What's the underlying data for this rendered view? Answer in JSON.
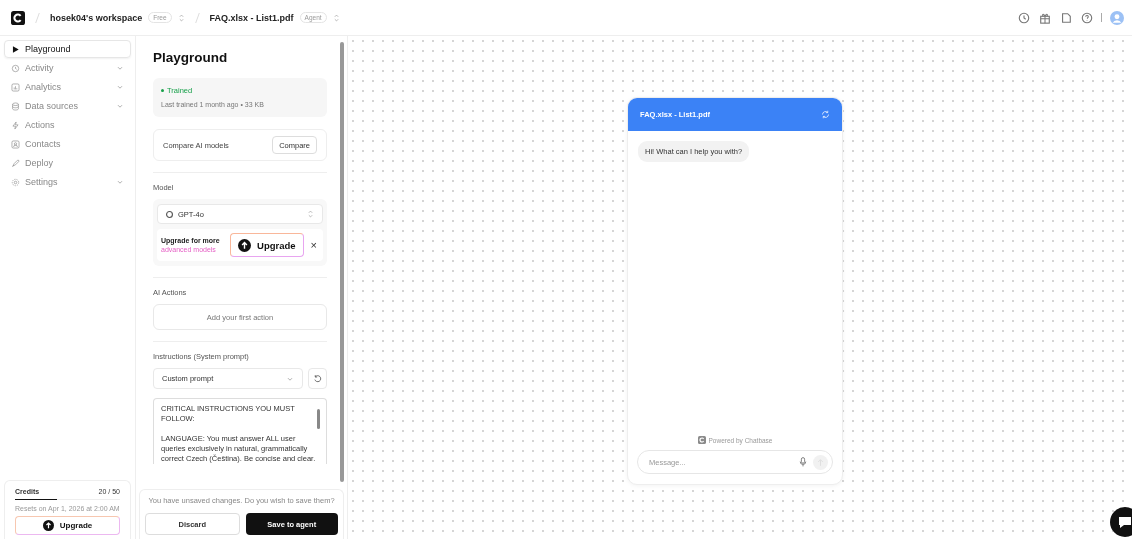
{
  "topbar": {
    "workspace": "hosek04's workspace",
    "plan_badge": "Free",
    "agent": "FAQ.xlsx - List1.pdf",
    "agent_badge": "Agent"
  },
  "sidebar": {
    "items": [
      {
        "label": "Playground",
        "selected": true,
        "expandable": false
      },
      {
        "label": "Activity",
        "selected": false,
        "expandable": true
      },
      {
        "label": "Analytics",
        "selected": false,
        "expandable": true
      },
      {
        "label": "Data sources",
        "selected": false,
        "expandable": true
      },
      {
        "label": "Actions",
        "selected": false,
        "expandable": false
      },
      {
        "label": "Contacts",
        "selected": false,
        "expandable": false
      },
      {
        "label": "Deploy",
        "selected": false,
        "expandable": false
      },
      {
        "label": "Settings",
        "selected": false,
        "expandable": true
      }
    ],
    "credits": {
      "label": "Credits",
      "count": "20 / 50",
      "level": 0.4,
      "reset": "Resets on Apr 1, 2026 at 2:00 AM",
      "button": "Upgrade"
    }
  },
  "panel": {
    "title": "Playground",
    "status": {
      "label": "Trained",
      "detail": "Last trained 1 month ago • 33 KB"
    },
    "compare": {
      "label": "Compare AI models",
      "button": "Compare"
    },
    "model": {
      "heading": "Model",
      "value": "GPT-4o",
      "upsell": "Upgrade for more",
      "upsell_link": "advanced models",
      "button": "Upgrade",
      "close": "×"
    },
    "actions": {
      "heading": "AI Actions",
      "button": "Add your first action"
    },
    "instructions": {
      "heading": "Instructions (System prompt)",
      "value": "Custom prompt",
      "prompt": "CRITICAL INSTRUCTIONS YOU MUST FOLLOW:\n\nLANGUAGE: You must answer ALL user queries exclusively in natural, grammatically correct Czech (Čeština). Be concise and clear."
    },
    "unsaved": {
      "message": "You have unsaved changes. Do you wish to save them?",
      "discard": "Discard",
      "save": "Save to agent"
    }
  },
  "chat": {
    "title": "FAQ.xlsx - List1.pdf",
    "messages": [
      "Hi! What can I help you with?"
    ],
    "powered": "Powered by Chatbase",
    "placeholder": "Message..."
  }
}
